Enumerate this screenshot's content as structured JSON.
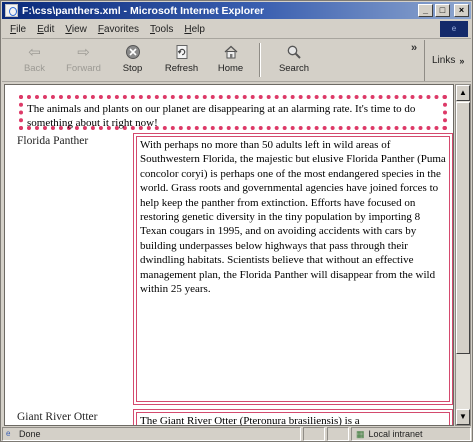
{
  "window": {
    "title": "F:\\css\\panthers.xml - Microsoft Internet Explorer"
  },
  "menu": [
    "File",
    "Edit",
    "View",
    "Favorites",
    "Tools",
    "Help"
  ],
  "toolbar": {
    "back": "Back",
    "forward": "Forward",
    "stop": "Stop",
    "refresh": "Refresh",
    "home": "Home",
    "search": "Search",
    "more": "»",
    "links": "Links"
  },
  "page": {
    "intro": "The animals and plants on our planet are disappearing at an alarming rate. It's time to do something about it right now!",
    "animals": [
      {
        "name": "Florida Panther",
        "description": "With perhaps no more than 50 adults left in wild areas of Southwestern Florida, the majestic but elusive Florida Panther (Puma concolor coryi) is perhaps one of the most endangered species in the world. Grass roots and governmental agencies have joined forces to help keep the panther from extinction. Efforts have focused on restoring genetic diversity in the tiny population by importing 8 Texan cougars in 1995, and on avoiding accidents with cars by building underpasses below highways that pass through their dwindling habitats. Scientists believe that without an effective management plan, the Florida Panther will disappear from the wild within 25 years."
      },
      {
        "name": "Giant River Otter",
        "description": "The Giant River Otter (Pteronura brasiliensis) is a"
      }
    ]
  },
  "status": {
    "text": "Done",
    "zone": "Local intranet"
  },
  "colors": {
    "border_accent": "#dd3a68",
    "titlebar": "#0a2a7a"
  }
}
